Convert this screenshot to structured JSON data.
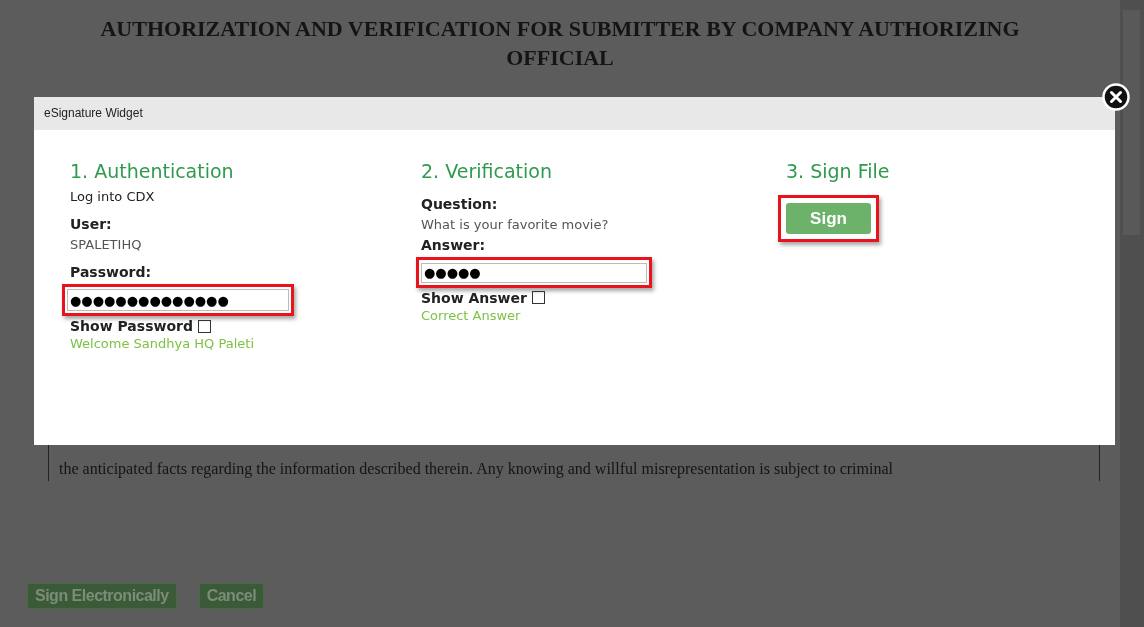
{
  "page": {
    "title": "AUTHORIZATION AND VERIFICATION FOR SUBMITTER BY COMPANY AUTHORIZING OFFICIAL",
    "statement": "the anticipated facts regarding the information described therein. Any knowing and willful misrepresentation is subject to criminal",
    "buttons": [
      "Sign Electronically",
      "Cancel"
    ]
  },
  "dialog": {
    "title": "eSignature Widget",
    "authentication": {
      "heading": "1. Authentication",
      "intro": "Log into CDX",
      "user_label": "User:",
      "user": "SPALETIHQ",
      "password_label": "Password:",
      "password": "●●●●●●●●●●●●●●",
      "show_label": "Show Password",
      "show_checked": false,
      "message": "Welcome Sandhya HQ Paleti"
    },
    "verification": {
      "heading": "2. Verification",
      "question_label": "Question:",
      "question": "What is your favorite movie?",
      "answer_label": "Answer:",
      "answer": "●●●●●",
      "show_label": "Show Answer",
      "show_checked": false,
      "message": "Correct Answer"
    },
    "sign": {
      "heading": "3. Sign File",
      "button": "Sign"
    }
  }
}
